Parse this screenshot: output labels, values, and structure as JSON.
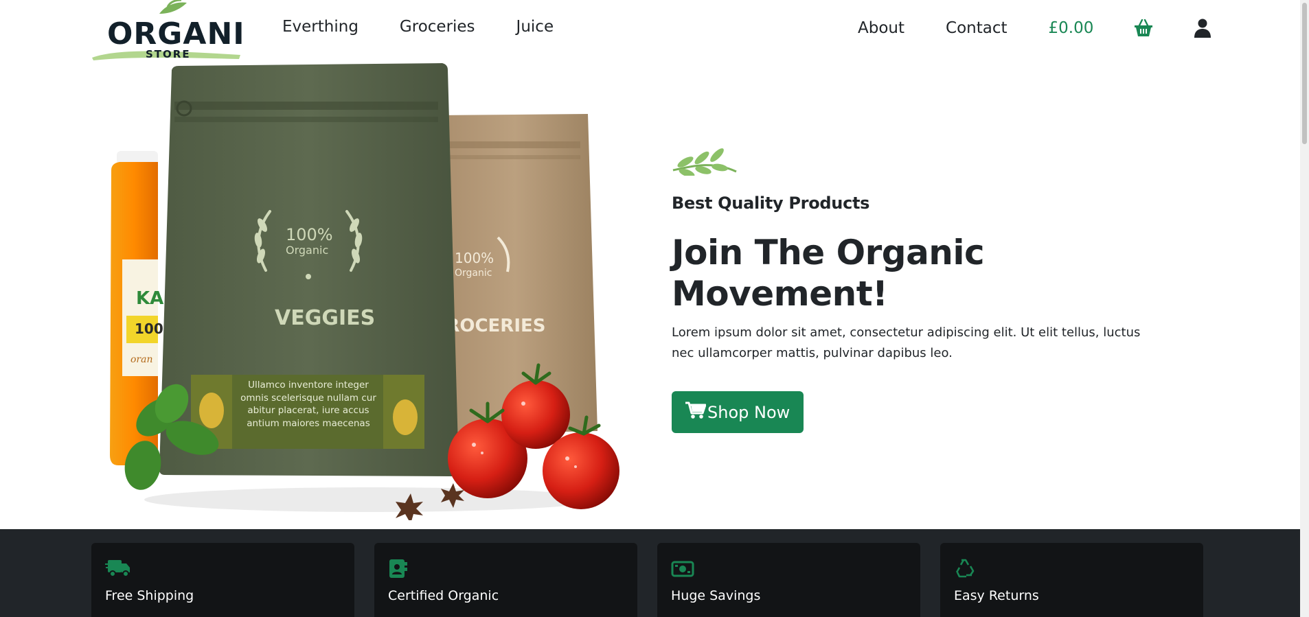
{
  "brand": {
    "logo_text": "ORGANIC",
    "logo_sub": "STORE"
  },
  "nav": {
    "left": [
      {
        "label": "Everthing"
      },
      {
        "label": "Groceries"
      },
      {
        "label": "Juice"
      }
    ],
    "right": [
      {
        "label": "About"
      },
      {
        "label": "Contact"
      }
    ],
    "cart_total": "£0.00",
    "cart_icon": "basket-icon",
    "account_icon": "user-icon"
  },
  "hero": {
    "subtitle": "Best Quality Products",
    "title": "Join The Organic Movement!",
    "description": "Lorem ipsum dolor sit amet, consectetur adipiscing elit. Ut elit tellus, luctus nec ullamcorper mattis, pulvinar dapibus leo.",
    "button_label": "Shop Now",
    "product_image": {
      "bag1_badge_line1": "100%",
      "bag1_badge_line2": "Organic",
      "bag1_name": "VEGGIES",
      "bag1_panel": "Ullamco inventore integer omnis scelerisque nullam cur abitur placerat, iure accus antium maiores maecenas",
      "bag2_badge_line1": "100%",
      "bag2_badge_line2": "Organic",
      "bag2_name": "GROCERIES"
    }
  },
  "features": [
    {
      "label": "Free Shipping",
      "icon": "truck-icon"
    },
    {
      "label": "Certified Organic",
      "icon": "certificate-icon"
    },
    {
      "label": "Huge Savings",
      "icon": "money-icon"
    },
    {
      "label": "Easy Returns",
      "icon": "recycle-icon"
    }
  ],
  "colors": {
    "accent": "#198754",
    "dark": "#212529",
    "card": "#121416"
  }
}
